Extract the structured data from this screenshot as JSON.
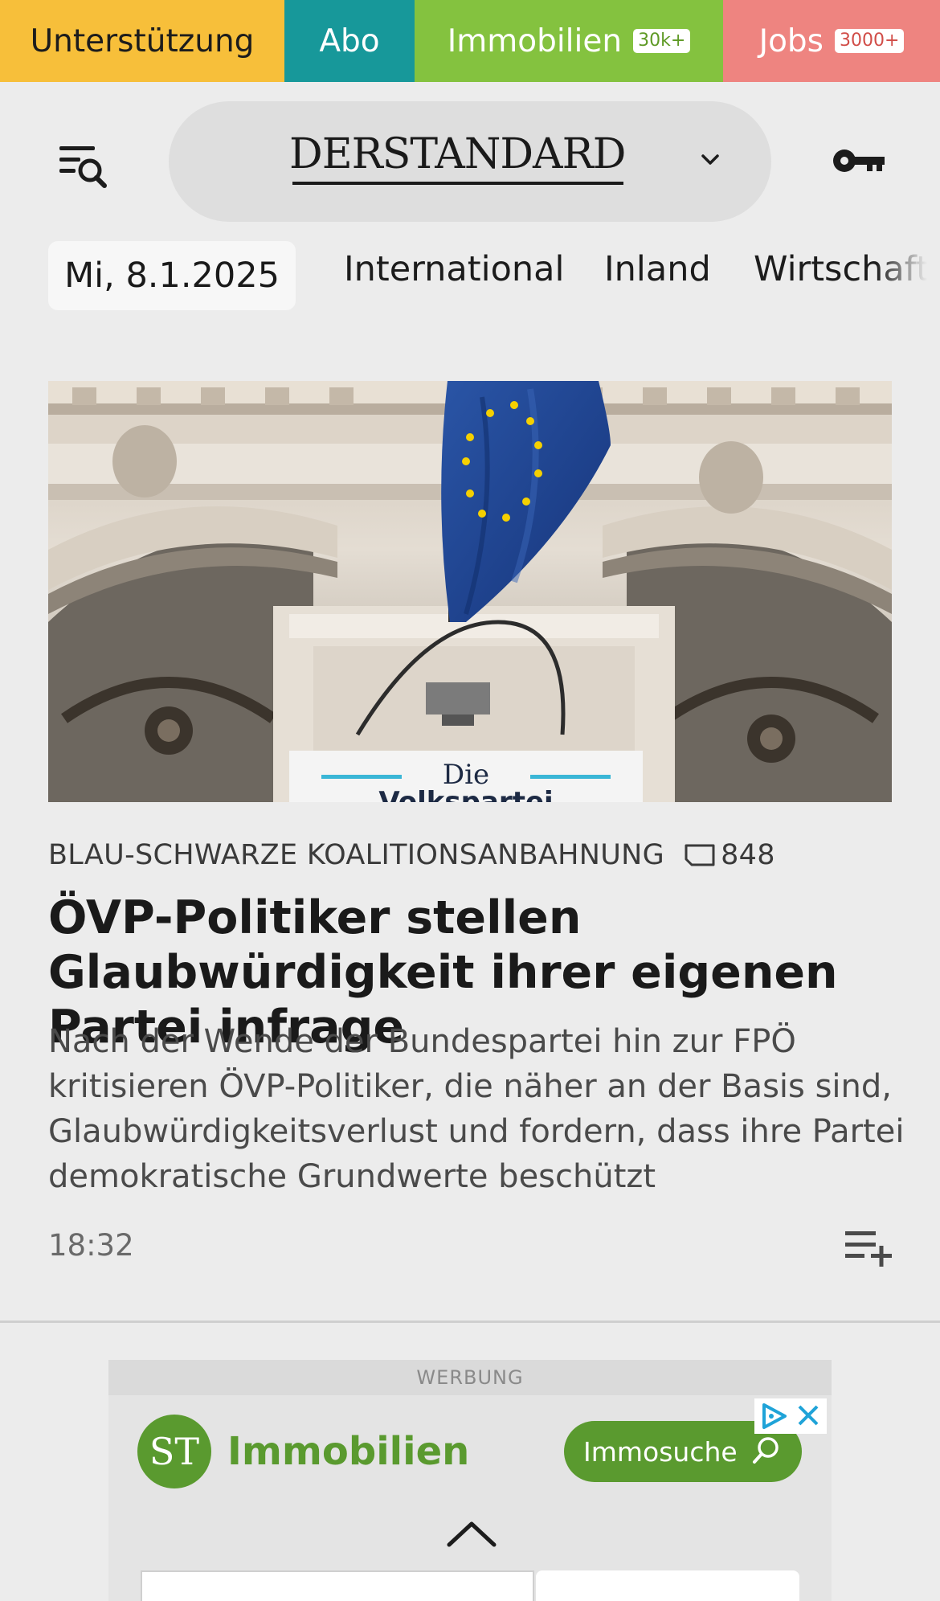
{
  "topbar": {
    "support": "Unterstützung",
    "abo": "Abo",
    "immobilien": "Immobilien",
    "immobilien_badge": "30k+",
    "jobs": "Jobs",
    "jobs_badge": "3000+"
  },
  "header": {
    "logo": "DERSTANDARD",
    "menu_icon": "menu-search-icon",
    "dropdown_icon": "chevron-down-icon",
    "login_icon": "key-icon"
  },
  "nav": {
    "date": "Mi, 8.1.2025",
    "items": [
      "International",
      "Inland",
      "Wirtschaft"
    ]
  },
  "article": {
    "kicker": "BLAU-SCHWARZE KOALITIONSANBAHNUNG",
    "comment_count": "848",
    "headline": "ÖVP-Politiker stellen Glaubwürdig­keit ihrer eigenen Partei infrage",
    "teaser": "Nach der Wende der Bundespartei hin zur FPÖ kritisieren ÖVP-Politiker, die näher an der Basis sind, Glaubwürdigkeitsverlust und fordern, dass ihre Partei demokratische Grundwerte beschützt",
    "time": "18:32",
    "image_sign_text": "Die Volkspartei"
  },
  "ad": {
    "label": "WERBUNG",
    "logo_text": "ST",
    "brand": "Immobilien",
    "cta": "Immosuche"
  },
  "colors": {
    "support": "#f7bf3a",
    "abo": "#17989a",
    "immobilien": "#84c23f",
    "jobs": "#ee8480",
    "ad_green": "#5a9a2f",
    "background": "#ececec"
  }
}
